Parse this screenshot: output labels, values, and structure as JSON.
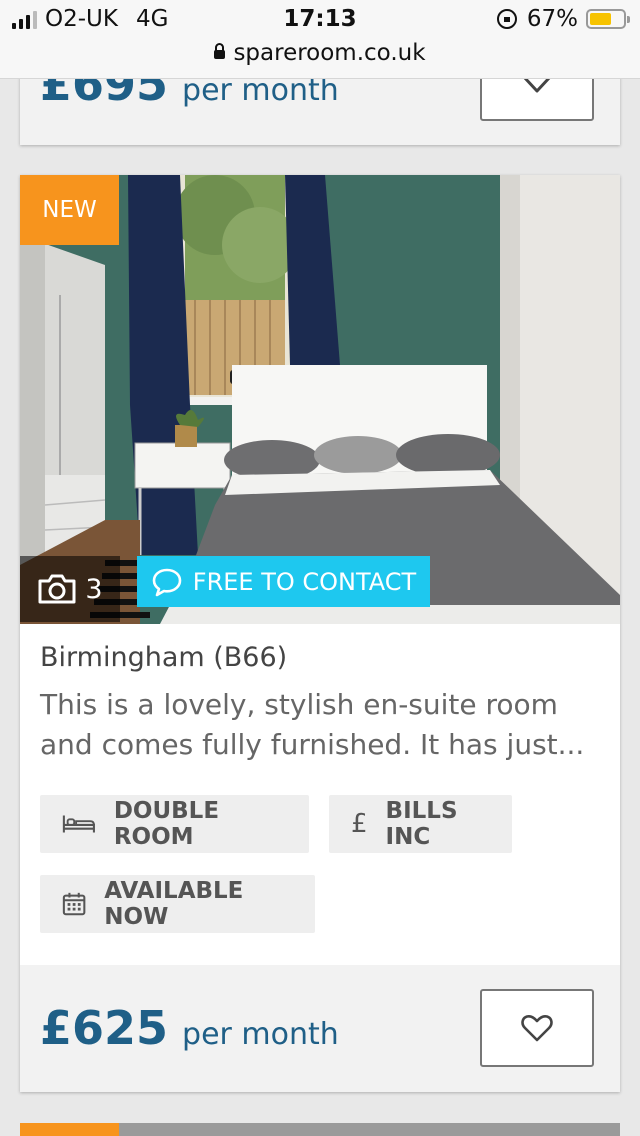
{
  "status_bar": {
    "carrier": "O2-UK",
    "network": "4G",
    "time": "17:13",
    "battery": "67%",
    "battery_level": 0.67,
    "url": "spareroom.co.uk"
  },
  "previous_listing": {
    "price": "£695",
    "period": "per month"
  },
  "listing": {
    "badge": "NEW",
    "photo_count": "3",
    "contact_label": "FREE TO CONTACT",
    "title": "Birmingham (B66)",
    "description": "This is a lovely, stylish en-suite room and comes fully furnished. It has just...",
    "features": {
      "room_type": "DOUBLE ROOM",
      "bills": "BILLS INC",
      "availability": "AVAILABLE NOW"
    },
    "price": "£625",
    "period": "per month"
  },
  "colors": {
    "accent_orange": "#f7941d",
    "contact_cyan": "#1ec8ef",
    "price_blue": "#1f5f87"
  },
  "icons": {
    "camera": "camera-icon",
    "chat": "chat-bubble-icon",
    "bed": "bed-icon",
    "pound": "pound-icon",
    "calendar": "calendar-icon",
    "heart": "heart-icon",
    "lock": "padlock-icon"
  }
}
